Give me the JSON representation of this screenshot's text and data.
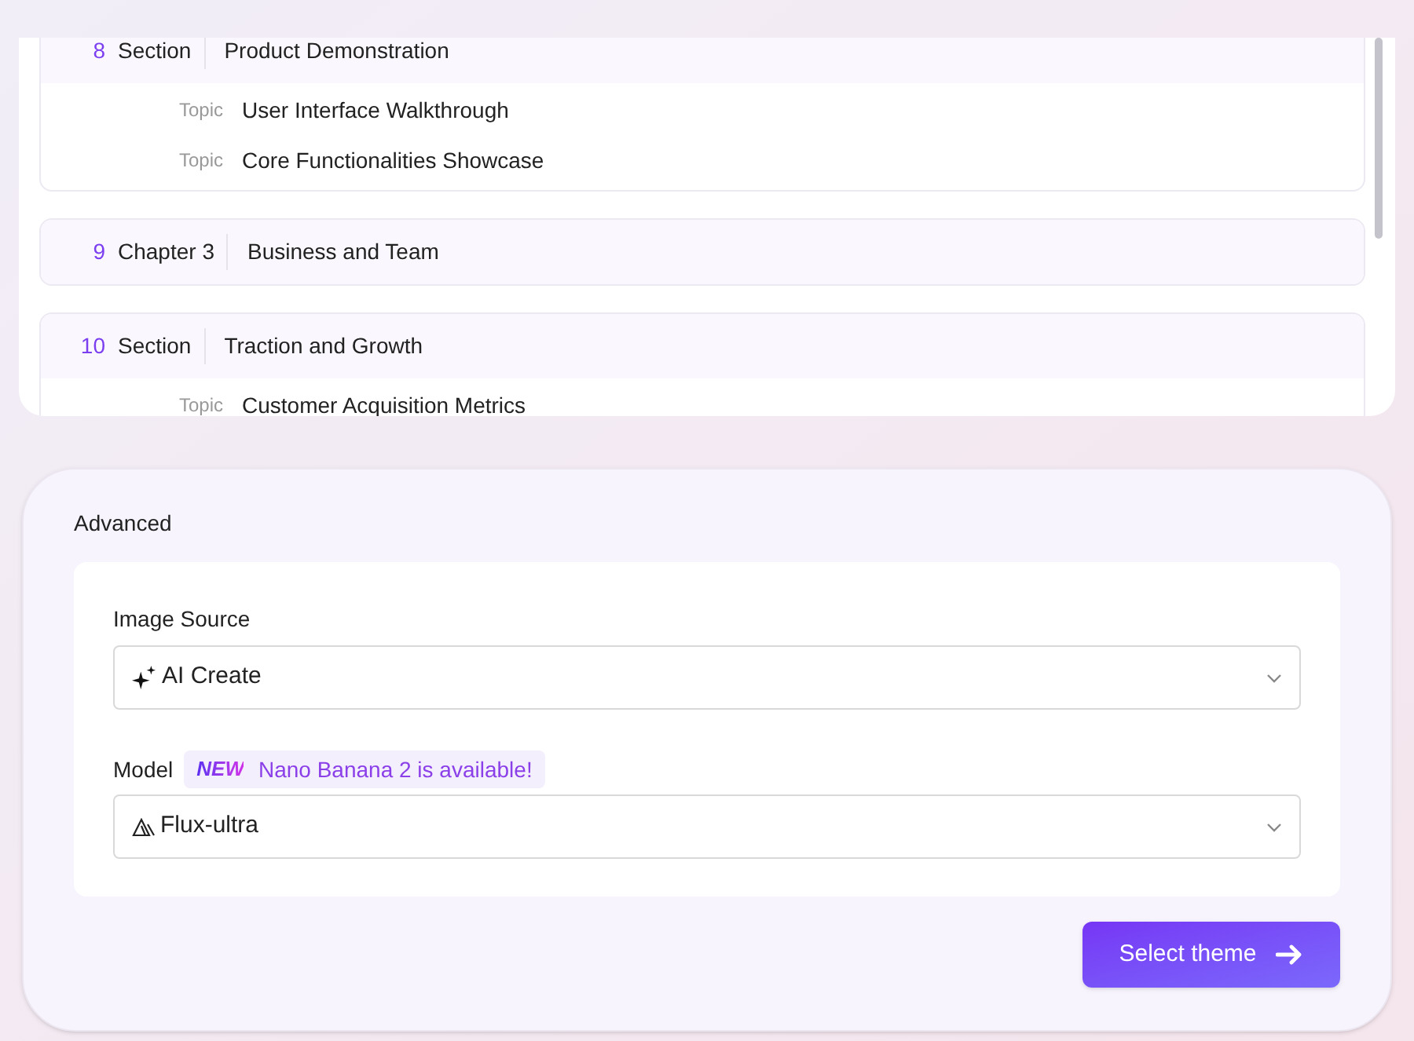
{
  "outline": [
    {
      "number": "8",
      "kind": "Section",
      "title": "Product Demonstration",
      "topics": [
        {
          "label": "Topic",
          "title": "User Interface Walkthrough"
        },
        {
          "label": "Topic",
          "title": "Core Functionalities Showcase"
        }
      ]
    },
    {
      "number": "9",
      "kind": "Chapter 3",
      "title": "Business and Team"
    },
    {
      "number": "10",
      "kind": "Section",
      "title": "Traction and Growth",
      "topics": [
        {
          "label": "Topic",
          "title": "Customer Acquisition Metrics"
        }
      ]
    }
  ],
  "advanced": {
    "title": "Advanced",
    "image_source": {
      "label": "Image Source",
      "value": "AI Create"
    },
    "model": {
      "label": "Model",
      "badge_tag": "NEW",
      "badge_text": "Nano Banana 2 is available!",
      "value": "Flux-ultra"
    },
    "submit": "Select theme"
  }
}
